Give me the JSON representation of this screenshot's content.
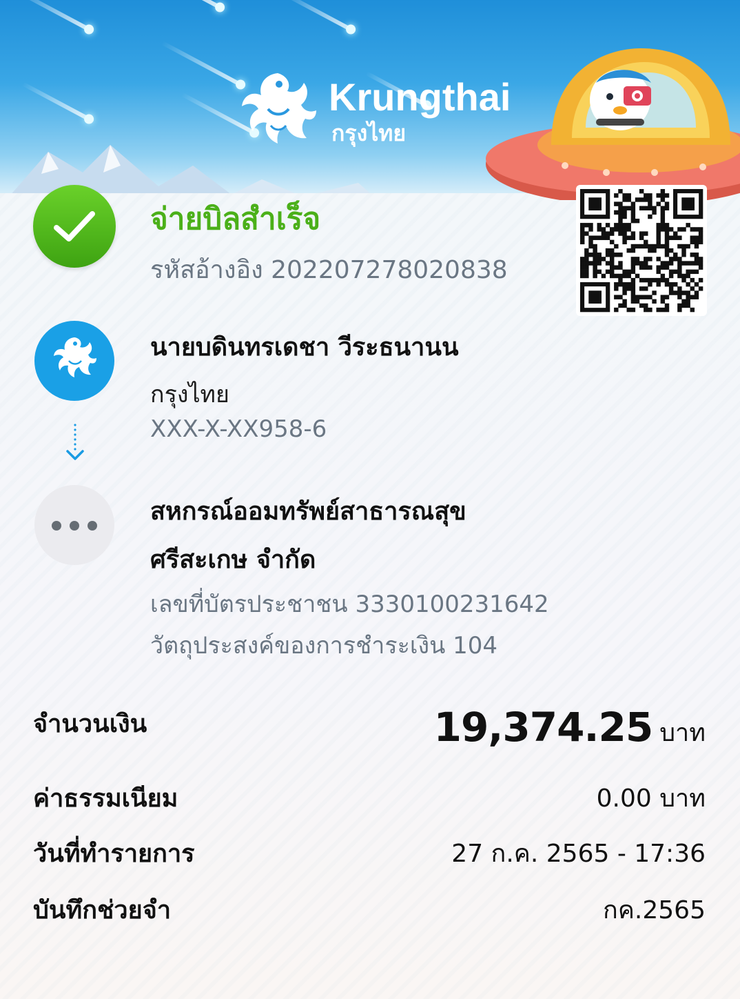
{
  "header": {
    "brand_name": "Krungthai",
    "brand_name_thai": "กรุงไทย"
  },
  "status": {
    "title": "จ่ายบิลสำเร็จ",
    "ref_label": "รหัสอ้างอิง",
    "ref_number": "202207278020838",
    "color": "#4bb019"
  },
  "sender": {
    "name": "นายบดินทรเดชา วีระธนานน",
    "bank": "กรุงไทย",
    "account": "XXX-X-XX958-6"
  },
  "receiver": {
    "name_line1": "สหกรณ์ออมทรัพย์สาธารณสุข",
    "name_line2": "ศรีสะเกษ จำกัด",
    "id_label": "เลขที่บัตรประชาชน",
    "id_value": "3330100231642",
    "purpose_label": "วัตถุประสงค์ของการชำระเงิน",
    "purpose_value": "104"
  },
  "details": {
    "amount_label": "จำนวนเงิน",
    "amount_value": "19,374.25",
    "amount_unit": "บาท",
    "fee_label": "ค่าธรรมเนียม",
    "fee_value": "0.00 บาท",
    "date_label": "วันที่ทำรายการ",
    "date_value": "27 ก.ค. 2565 - 17:36",
    "memo_label": "บันทึกช่วยจำ",
    "memo_value": "กค.2565"
  },
  "icons": {
    "status": "check-icon",
    "sender": "krungthai-garuda-icon",
    "transfer": "arrow-down-icon",
    "receiver": "more-dots-icon",
    "qr": "qr-code"
  }
}
